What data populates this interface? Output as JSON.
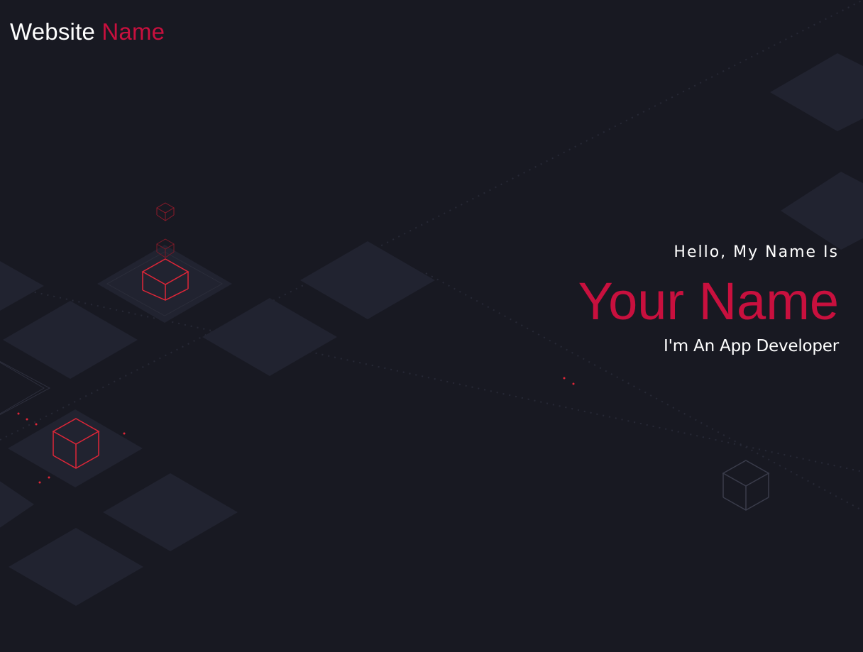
{
  "header": {
    "logo_primary": "Website",
    "logo_accent": "Name"
  },
  "hero": {
    "greeting": "Hello, My Name Is",
    "name": "Your Name",
    "role": "I'm An App Developer"
  },
  "colors": {
    "background": "#181922",
    "tile": "#212330",
    "accent": "#c8103e",
    "cube_red": "#e02638",
    "cube_dim": "#3a3c4b"
  }
}
